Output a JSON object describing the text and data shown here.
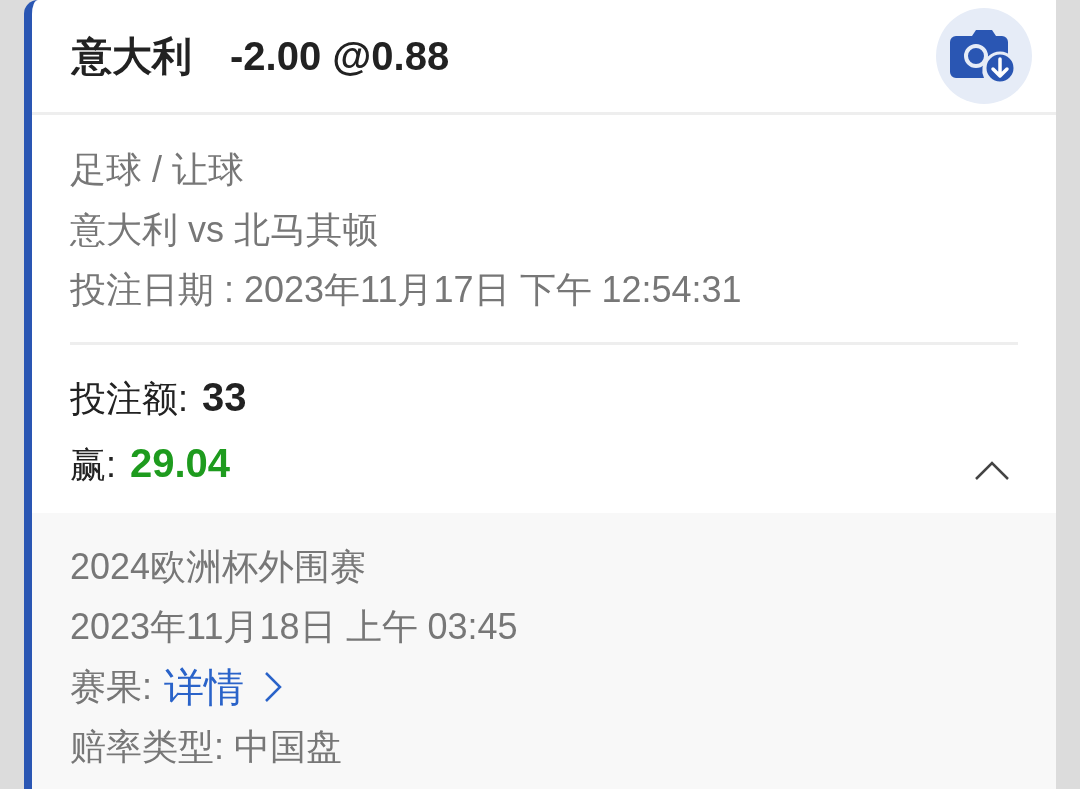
{
  "header": {
    "team": "意大利",
    "line": "-2.00 @0.88"
  },
  "info": [
    "足球 / 让球",
    "意大利 vs 北马其顿",
    "投注日期 : 2023年11月17日 下午 12:54:31"
  ],
  "stake": {
    "label": "投注额:",
    "value": "33"
  },
  "win": {
    "label": "赢:",
    "value": "29.04"
  },
  "expanded": true,
  "details": {
    "league": "2024欧洲杯外围赛",
    "kickoff": "2023年11月18日 上午 03:45",
    "result_label": "赛果:",
    "result_link": "详情",
    "odds_type": "赔率类型: 中国盘"
  }
}
